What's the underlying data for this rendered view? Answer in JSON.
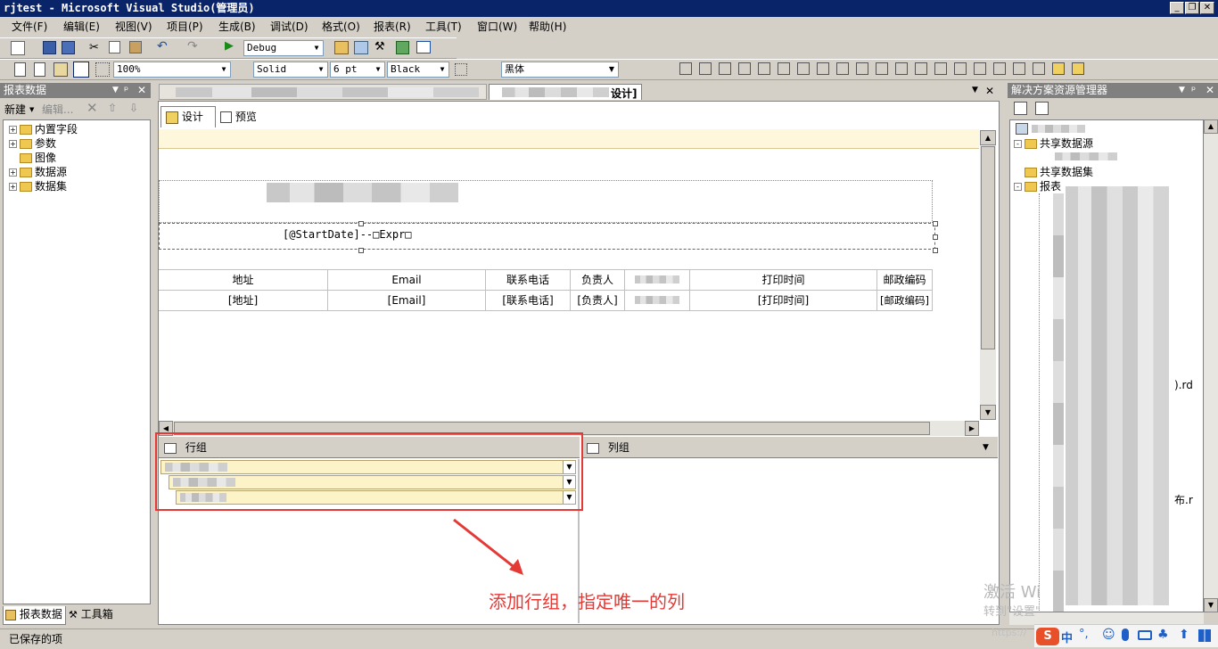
{
  "window": {
    "title": "rjtest - Microsoft Visual Studio(管理员)"
  },
  "menu": [
    "文件(F)",
    "编辑(E)",
    "视图(V)",
    "项目(P)",
    "生成(B)",
    "调试(D)",
    "格式(O)",
    "报表(R)",
    "工具(T)",
    "窗口(W)",
    "帮助(H)"
  ],
  "toolbar1": {
    "config": "Debug"
  },
  "toolbar2": {
    "zoom": "100%",
    "line_style": "Solid",
    "line_width": "6 pt",
    "color": "Black",
    "font": "黑体"
  },
  "report_data_panel": {
    "title": "报表数据",
    "new_label": "新建",
    "edit_label": "编辑...",
    "tree": [
      "内置字段",
      "参数",
      "图像",
      "数据源",
      "数据集"
    ]
  },
  "bottom_tabs": {
    "report_data": "报表数据",
    "toolbox": "工具箱"
  },
  "doc_tab": {
    "active": "设计]"
  },
  "designer_tabs": {
    "design": "设计",
    "preview": "预览"
  },
  "report": {
    "textbox_expr": "[@StartDate]--□Expr□",
    "headers": [
      "地址",
      "Email",
      "联系电话",
      "负责人",
      "",
      "打印时间",
      "邮政编码"
    ],
    "values": [
      "[地址]",
      "[Email]",
      "[联系电话]",
      "[负责人]",
      "",
      "[打印时间]",
      "[邮政编码]"
    ]
  },
  "grouping": {
    "row_groups_label": "行组",
    "col_groups_label": "列组"
  },
  "annotation": {
    "text": "添加行组，指定唯一的列",
    "color": "#e53935"
  },
  "solution_panel": {
    "title": "解决方案资源管理器",
    "shared_ds": "共享数据源",
    "shared_dsets": "共享数据集",
    "reports": "报表",
    "partial1": ").rd",
    "partial2": "布.r"
  },
  "watermark": {
    "line1": "激活 Wi",
    "line2": "转到\"设置\""
  },
  "status": {
    "text": "已保存的项"
  },
  "tray": {
    "ime": "中",
    "punct": "°,",
    "url": "https://"
  }
}
